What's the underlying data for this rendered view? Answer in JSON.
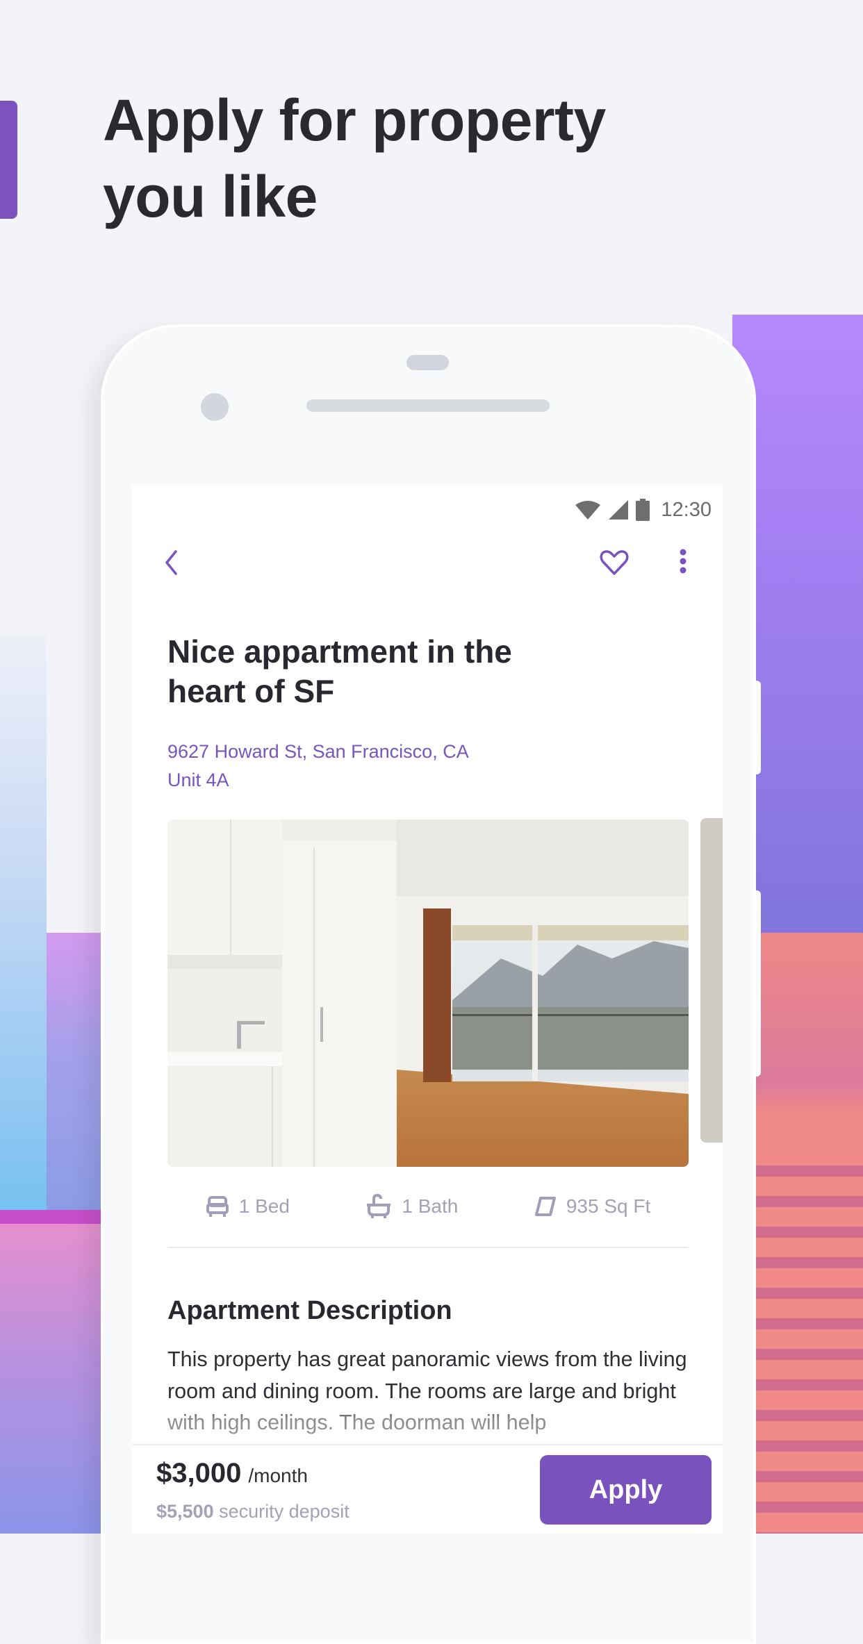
{
  "headline": {
    "line1": "Apply for property",
    "line2": "you like"
  },
  "colors": {
    "accent": "#7952BE",
    "address": "#7556BE",
    "muted": "#A4A0B6",
    "text": "#29282F",
    "background": "#F3F4F7"
  },
  "status_bar": {
    "time": "12:30",
    "icons": [
      "wifi-icon",
      "cellular-signal-icon",
      "battery-icon"
    ]
  },
  "nav": {
    "back_icon": "chevron-left-icon",
    "favorite_icon": "heart-outline-icon",
    "more_icon": "more-vertical-icon"
  },
  "listing": {
    "title_line1": "Nice appartment in the",
    "title_line2": "heart of SF",
    "address_line1": "9627 Howard St, San Francisco, CA",
    "address_line2": "Unit 4A",
    "photo_alt": "Bright empty apartment with kitchen and balcony view of mountains"
  },
  "features": [
    {
      "icon": "bed-icon",
      "label": "1 Bed"
    },
    {
      "icon": "bathtub-icon",
      "label": "1 Bath"
    },
    {
      "icon": "area-icon",
      "label": "935 Sq Ft"
    }
  ],
  "description": {
    "heading": "Apartment Description",
    "text": "This property has great panoramic views from the living room and dining room. The rooms are large and bright with high ceilings. The doorman will help"
  },
  "footer": {
    "price": "$3,000",
    "price_period": "/month",
    "deposit_amount": "$5,500",
    "deposit_label": "security deposit",
    "apply_label": "Apply"
  }
}
